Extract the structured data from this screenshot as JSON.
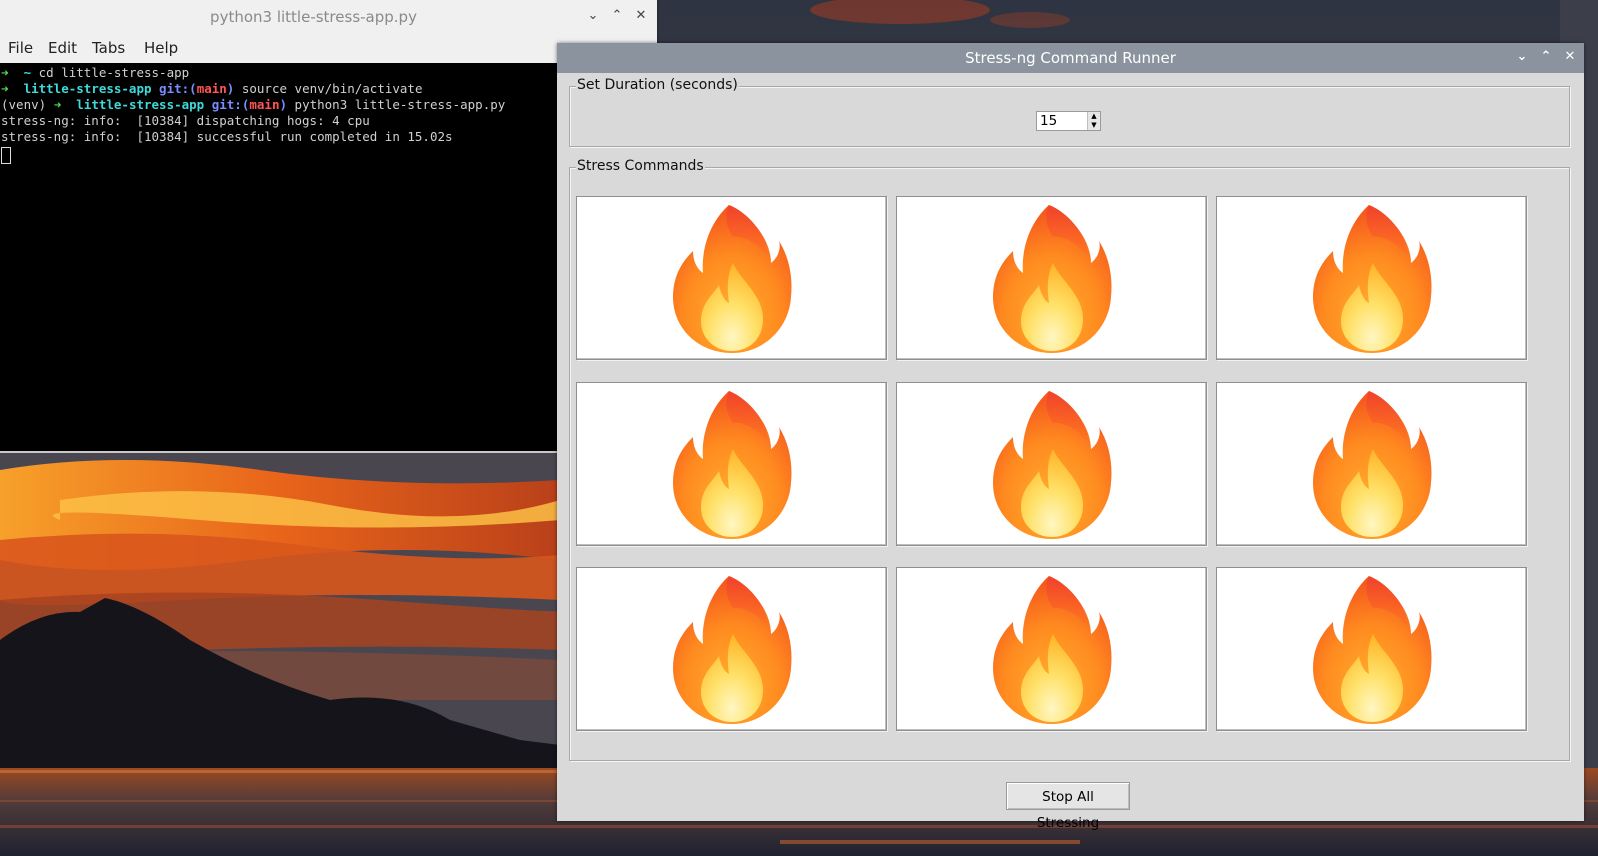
{
  "terminal": {
    "title": "python3 little-stress-app.py",
    "menu": [
      "File",
      "Edit",
      "Tabs",
      "Help"
    ],
    "lines": [
      {
        "segments": [
          {
            "t": "➜  ",
            "c": "c-green"
          },
          {
            "t": "~ ",
            "c": "c-cyan"
          },
          {
            "t": "cd little-stress-app",
            "c": ""
          }
        ]
      },
      {
        "segments": [
          {
            "t": "➜  ",
            "c": "c-green"
          },
          {
            "t": "little-stress-app ",
            "c": "c-cyan"
          },
          {
            "t": "git:(",
            "c": "c-blue"
          },
          {
            "t": "main",
            "c": "c-red"
          },
          {
            "t": ") ",
            "c": "c-blue"
          },
          {
            "t": "source venv/bin/activate",
            "c": ""
          }
        ]
      },
      {
        "segments": [
          {
            "t": "(venv) ",
            "c": ""
          },
          {
            "t": "➜  ",
            "c": "c-green"
          },
          {
            "t": "little-stress-app ",
            "c": "c-cyan"
          },
          {
            "t": "git:(",
            "c": "c-blue"
          },
          {
            "t": "main",
            "c": "c-red"
          },
          {
            "t": ") ",
            "c": "c-blue"
          },
          {
            "t": "python3 little-stress-app.py",
            "c": ""
          }
        ]
      },
      {
        "segments": [
          {
            "t": "stress-ng: info:  [10384] dispatching hogs: 4 cpu",
            "c": ""
          }
        ]
      },
      {
        "segments": [
          {
            "t": "stress-ng: info:  [10384] successful run completed in 15.02s",
            "c": ""
          }
        ]
      }
    ]
  },
  "app": {
    "title": "Stress-ng Command Runner",
    "duration_group_label": "Set Duration (seconds)",
    "duration_value": "15",
    "commands_group_label": "Stress Commands",
    "stress_buttons": [
      {
        "icon": "fire-icon"
      },
      {
        "icon": "fire-icon"
      },
      {
        "icon": "fire-icon"
      },
      {
        "icon": "fire-icon"
      },
      {
        "icon": "fire-icon"
      },
      {
        "icon": "fire-icon"
      },
      {
        "icon": "fire-icon"
      },
      {
        "icon": "fire-icon"
      },
      {
        "icon": "fire-icon"
      }
    ],
    "stop_label": "Stop All Stressing"
  },
  "window_controls": {
    "minimize": "⌄",
    "maximize": "⌃",
    "close": "✕"
  }
}
